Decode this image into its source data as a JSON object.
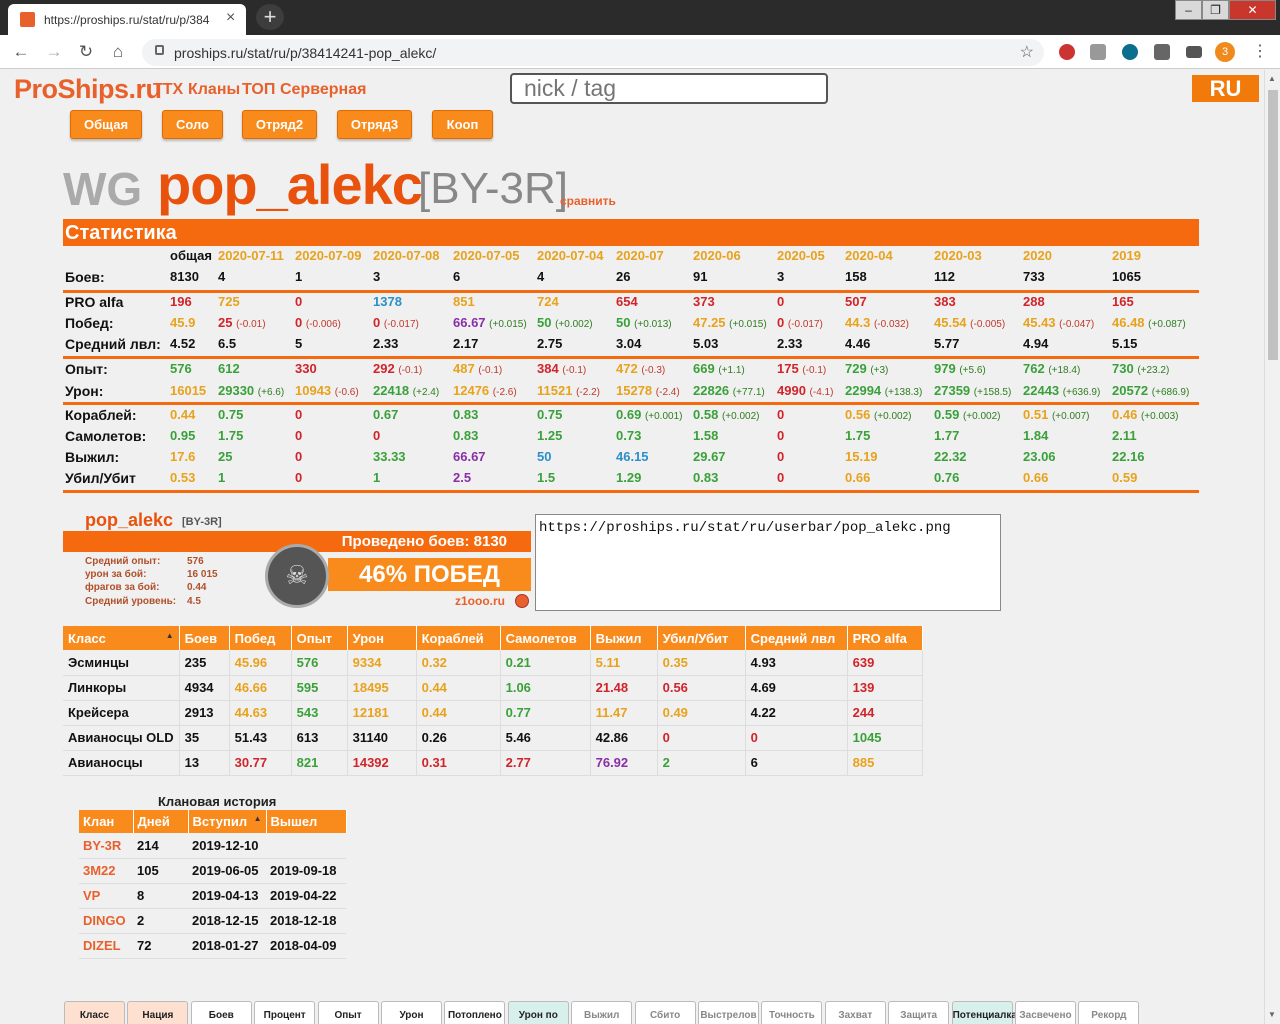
{
  "browser": {
    "tab_title": "https://proships.ru/stat/ru/p/384",
    "url": "proships.ru/stat/ru/p/38414241-pop_alekc/",
    "profile_initial": "3"
  },
  "site": {
    "logo": "ProShips.ru",
    "nav": [
      "ТТХ",
      "Кланы",
      "ТОП",
      "Серверная"
    ],
    "search_placeholder": "nick / tag",
    "lang": "RU"
  },
  "mode_tabs": [
    "Общая",
    "Соло",
    "Отряд2",
    "Отряд3",
    "Кооп"
  ],
  "player": {
    "server": "WG",
    "name": "pop_alekc",
    "clan": "[BY-3R]",
    "compare": "сравнить"
  },
  "stats": {
    "title": "Статистика",
    "columns": [
      "общая",
      "2020-07-11",
      "2020-07-09",
      "2020-07-08",
      "2020-07-05",
      "2020-07-04",
      "2020-07",
      "2020-06",
      "2020-05",
      "2020-04",
      "2020-03",
      "2020",
      "2019"
    ],
    "battles_label": "Боев:",
    "battles": [
      "8130",
      "4",
      "1",
      "3",
      "6",
      "4",
      "26",
      "91",
      "3",
      "158",
      "112",
      "733",
      "1065"
    ],
    "rows": [
      {
        "label": "PRO alfa",
        "cells": [
          [
            "196",
            "",
            "r"
          ],
          [
            "725",
            "",
            "o"
          ],
          [
            "0",
            "",
            "r"
          ],
          [
            "1378",
            "",
            "b"
          ],
          [
            "851",
            "",
            "o"
          ],
          [
            "724",
            "",
            "o"
          ],
          [
            "654",
            "",
            "r"
          ],
          [
            "373",
            "",
            "r"
          ],
          [
            "0",
            "",
            "r"
          ],
          [
            "507",
            "",
            "r"
          ],
          [
            "383",
            "",
            "r"
          ],
          [
            "288",
            "",
            "r"
          ],
          [
            "165",
            "",
            "r"
          ]
        ]
      },
      {
        "label": "Побед:",
        "cells": [
          [
            "45.9",
            "",
            "o"
          ],
          [
            "25",
            "(-0.01)",
            "r"
          ],
          [
            "0",
            "(-0.006)",
            "r"
          ],
          [
            "0",
            "(-0.017)",
            "r"
          ],
          [
            "66.67",
            "(+0.015)",
            "p"
          ],
          [
            "50",
            "(+0.002)",
            "g"
          ],
          [
            "50",
            "(+0.013)",
            "g"
          ],
          [
            "47.25",
            "(+0.015)",
            "o"
          ],
          [
            "0",
            "(-0.017)",
            "r"
          ],
          [
            "44.3",
            "(-0.032)",
            "o"
          ],
          [
            "45.54",
            "(-0.005)",
            "o"
          ],
          [
            "45.43",
            "(-0.047)",
            "o"
          ],
          [
            "46.48",
            "(+0.087)",
            "o"
          ]
        ]
      },
      {
        "label": "Средний лвл:",
        "cells": [
          [
            "4.52",
            "",
            "k"
          ],
          [
            "6.5",
            "",
            "k"
          ],
          [
            "5",
            "",
            "k"
          ],
          [
            "2.33",
            "",
            "k"
          ],
          [
            "2.17",
            "",
            "k"
          ],
          [
            "2.75",
            "",
            "k"
          ],
          [
            "3.04",
            "",
            "k"
          ],
          [
            "5.03",
            "",
            "k"
          ],
          [
            "2.33",
            "",
            "k"
          ],
          [
            "4.46",
            "",
            "k"
          ],
          [
            "5.77",
            "",
            "k"
          ],
          [
            "4.94",
            "",
            "k"
          ],
          [
            "5.15",
            "",
            "k"
          ]
        ]
      },
      {
        "label": "Опыт:",
        "cells": [
          [
            "576",
            "",
            "g"
          ],
          [
            "612",
            "",
            "g"
          ],
          [
            "330",
            "",
            "r"
          ],
          [
            "292",
            "(-0.1)",
            "r"
          ],
          [
            "487",
            "(-0.1)",
            "o"
          ],
          [
            "384",
            "(-0.1)",
            "r"
          ],
          [
            "472",
            "(-0.3)",
            "o"
          ],
          [
            "669",
            "(+1.1)",
            "g"
          ],
          [
            "175",
            "(-0.1)",
            "r"
          ],
          [
            "729",
            "(+3)",
            "g"
          ],
          [
            "979",
            "(+5.6)",
            "g"
          ],
          [
            "762",
            "(+18.4)",
            "g"
          ],
          [
            "730",
            "(+23.2)",
            "g"
          ]
        ]
      },
      {
        "label": "Урон:",
        "cells": [
          [
            "16015",
            "",
            "o"
          ],
          [
            "29330",
            "(+6.6)",
            "g"
          ],
          [
            "10943",
            "(-0.6)",
            "o"
          ],
          [
            "22418",
            "(+2.4)",
            "g"
          ],
          [
            "12476",
            "(-2.6)",
            "o"
          ],
          [
            "11521",
            "(-2.2)",
            "o"
          ],
          [
            "15278",
            "(-2.4)",
            "o"
          ],
          [
            "22826",
            "(+77.1)",
            "g"
          ],
          [
            "4990",
            "(-4.1)",
            "r"
          ],
          [
            "22994",
            "(+138.3)",
            "g"
          ],
          [
            "27359",
            "(+158.5)",
            "g"
          ],
          [
            "22443",
            "(+636.9)",
            "g"
          ],
          [
            "20572",
            "(+686.9)",
            "g"
          ]
        ]
      },
      {
        "label": "Кораблей:",
        "cells": [
          [
            "0.44",
            "",
            "o"
          ],
          [
            "0.75",
            "",
            "g"
          ],
          [
            "0",
            "",
            "r"
          ],
          [
            "0.67",
            "",
            "g"
          ],
          [
            "0.83",
            "",
            "g"
          ],
          [
            "0.75",
            "",
            "g"
          ],
          [
            "0.69",
            "(+0.001)",
            "g"
          ],
          [
            "0.58",
            "(+0.002)",
            "g"
          ],
          [
            "0",
            "",
            "r"
          ],
          [
            "0.56",
            "(+0.002)",
            "o"
          ],
          [
            "0.59",
            "(+0.002)",
            "g"
          ],
          [
            "0.51",
            "(+0.007)",
            "o"
          ],
          [
            "0.46",
            "(+0.003)",
            "o"
          ]
        ]
      },
      {
        "label": "Самолетов:",
        "cells": [
          [
            "0.95",
            "",
            "g"
          ],
          [
            "1.75",
            "",
            "g"
          ],
          [
            "0",
            "",
            "r"
          ],
          [
            "0",
            "",
            "r"
          ],
          [
            "0.83",
            "",
            "g"
          ],
          [
            "1.25",
            "",
            "g"
          ],
          [
            "0.73",
            "",
            "g"
          ],
          [
            "1.58",
            "",
            "g"
          ],
          [
            "0",
            "",
            "r"
          ],
          [
            "1.75",
            "",
            "g"
          ],
          [
            "1.77",
            "",
            "g"
          ],
          [
            "1.84",
            "",
            "g"
          ],
          [
            "2.11",
            "",
            "g"
          ]
        ]
      },
      {
        "label": "Выжил:",
        "cells": [
          [
            "17.6",
            "",
            "o"
          ],
          [
            "25",
            "",
            "g"
          ],
          [
            "0",
            "",
            "r"
          ],
          [
            "33.33",
            "",
            "g"
          ],
          [
            "66.67",
            "",
            "p"
          ],
          [
            "50",
            "",
            "b"
          ],
          [
            "46.15",
            "",
            "b"
          ],
          [
            "29.67",
            "",
            "g"
          ],
          [
            "0",
            "",
            "r"
          ],
          [
            "15.19",
            "",
            "o"
          ],
          [
            "22.32",
            "",
            "g"
          ],
          [
            "23.06",
            "",
            "g"
          ],
          [
            "22.16",
            "",
            "g"
          ]
        ]
      },
      {
        "label": "Убил/Убит",
        "cells": [
          [
            "0.53",
            "",
            "o"
          ],
          [
            "1",
            "",
            "g"
          ],
          [
            "0",
            "",
            "r"
          ],
          [
            "1",
            "",
            "g"
          ],
          [
            "2.5",
            "",
            "p"
          ],
          [
            "1.5",
            "",
            "g"
          ],
          [
            "1.29",
            "",
            "g"
          ],
          [
            "0.83",
            "",
            "g"
          ],
          [
            "0",
            "",
            "r"
          ],
          [
            "0.66",
            "",
            "o"
          ],
          [
            "0.76",
            "",
            "g"
          ],
          [
            "0.66",
            "",
            "o"
          ],
          [
            "0.59",
            "",
            "o"
          ]
        ]
      }
    ]
  },
  "userbar": {
    "name": "pop_alekc",
    "tag": "[BY-3R]",
    "battles_text": "Проведено боев: 8130",
    "win_text": "46% ПОБЕД",
    "site": "z1ooo.ru",
    "lines": [
      [
        "Средний опыт:",
        "576"
      ],
      [
        "урон за бой:",
        "16 015"
      ],
      [
        "фрагов за бой:",
        "0.44"
      ],
      [
        "Средний уровень:",
        "4.5"
      ]
    ],
    "url": "https://proships.ru/stat/ru/userbar/pop_alekc.png"
  },
  "class_table": {
    "headers": [
      "Класс",
      "Боев",
      "Побед",
      "Опыт",
      "Урон",
      "Кораблей",
      "Самолетов",
      "Выжил",
      "Убил/Убит",
      "Средний лвл",
      "PRO alfa"
    ],
    "rows": [
      [
        [
          "Эсминцы",
          "k"
        ],
        [
          "235",
          "k"
        ],
        [
          "45.96",
          "o"
        ],
        [
          "576",
          "g"
        ],
        [
          "9334",
          "o"
        ],
        [
          "0.32",
          "o"
        ],
        [
          "0.21",
          "g"
        ],
        [
          "5.11",
          "o"
        ],
        [
          "0.35",
          "o"
        ],
        [
          "4.93",
          "k"
        ],
        [
          "639",
          "r"
        ]
      ],
      [
        [
          "Линкоры",
          "k"
        ],
        [
          "4934",
          "k"
        ],
        [
          "46.66",
          "o"
        ],
        [
          "595",
          "g"
        ],
        [
          "18495",
          "o"
        ],
        [
          "0.44",
          "o"
        ],
        [
          "1.06",
          "g"
        ],
        [
          "21.48",
          "r"
        ],
        [
          "0.56",
          "r"
        ],
        [
          "4.69",
          "k"
        ],
        [
          "139",
          "r"
        ]
      ],
      [
        [
          "Крейсера",
          "k"
        ],
        [
          "2913",
          "k"
        ],
        [
          "44.63",
          "o"
        ],
        [
          "543",
          "g"
        ],
        [
          "12181",
          "o"
        ],
        [
          "0.44",
          "o"
        ],
        [
          "0.77",
          "g"
        ],
        [
          "11.47",
          "o"
        ],
        [
          "0.49",
          "o"
        ],
        [
          "4.22",
          "k"
        ],
        [
          "244",
          "r"
        ]
      ],
      [
        [
          "Авианосцы OLD",
          "k"
        ],
        [
          "35",
          "k"
        ],
        [
          "51.43",
          "k"
        ],
        [
          "613",
          "k"
        ],
        [
          "31140",
          "k"
        ],
        [
          "0.26",
          "k"
        ],
        [
          "5.46",
          "k"
        ],
        [
          "42.86",
          "k"
        ],
        [
          "0",
          "r"
        ],
        [
          "0",
          "r"
        ],
        [
          "1045",
          "g"
        ]
      ],
      [
        [
          "Авианосцы",
          "k"
        ],
        [
          "13",
          "k"
        ],
        [
          "30.77",
          "r"
        ],
        [
          "821",
          "g"
        ],
        [
          "14392",
          "r"
        ],
        [
          "0.31",
          "r"
        ],
        [
          "2.77",
          "r"
        ],
        [
          "76.92",
          "p"
        ],
        [
          "2",
          "g"
        ],
        [
          "6",
          "k"
        ],
        [
          "885",
          "o"
        ]
      ]
    ]
  },
  "clan_history": {
    "title": "Клановая история",
    "headers": [
      "Клан",
      "Дней",
      "Вступил",
      "Вышел"
    ],
    "rows": [
      [
        "BY-3R",
        "214",
        "2019-12-10",
        ""
      ],
      [
        "3M22",
        "105",
        "2019-06-05",
        "2019-09-18"
      ],
      [
        "VP",
        "8",
        "2019-04-13",
        "2019-04-22"
      ],
      [
        "DINGO",
        "2",
        "2018-12-15",
        "2018-12-18"
      ],
      [
        "DIZEL",
        "72",
        "2018-01-27",
        "2018-04-09"
      ]
    ]
  },
  "bottom_tabs": [
    "Класс",
    "Нация",
    "Боев",
    "Процент",
    "Опыт",
    "Урон",
    "Потоплено",
    "Урон по",
    "Выжил",
    "Сбито",
    "Выстрелов",
    "Точность",
    "Захват",
    "Защита",
    "Потенциалка",
    "Засвечено",
    "Рекорд"
  ]
}
